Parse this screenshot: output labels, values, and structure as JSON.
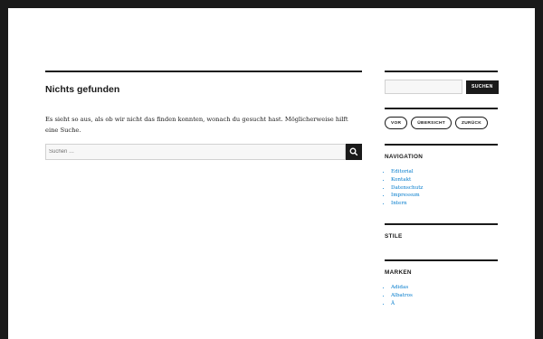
{
  "main": {
    "title": "Nichts gefunden",
    "message": "Es sieht so aus, als ob wir nicht das finden konnten, wonach du gesucht hast. Möglicherweise hilft eine Suche.",
    "search": {
      "placeholder": "Suchen …",
      "value": "",
      "submit_icon": "search-icon"
    }
  },
  "sidebar": {
    "search": {
      "value": "",
      "button_label": "SUCHEN"
    },
    "pager": {
      "prev_label": "VOR",
      "overview_label": "ÜBERSICHT",
      "back_label": "ZURÜCK"
    },
    "navigation": {
      "title": "NAVIGATION",
      "items": [
        "Editorial",
        "Kontakt",
        "Datenschutz",
        "Impressum",
        "Intern"
      ]
    },
    "styles": {
      "title": "STILE"
    },
    "brands": {
      "title": "MARKEN",
      "items": [
        "Adidas",
        "Albatros",
        "Ä"
      ]
    }
  },
  "colors": {
    "link": "#007acc",
    "text": "#1a1a1a",
    "frame": "#1a1a1a",
    "input_bg": "#f7f7f7"
  }
}
